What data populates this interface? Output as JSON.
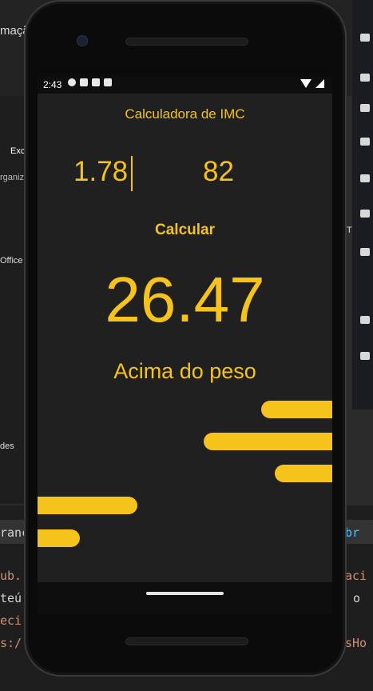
{
  "desktop": {
    "top_text": "maçã",
    "left_label_excluir": "Exc",
    "left_label_organize": "rganiz",
    "left_label_office": "Office",
    "left_label_des": "des",
    "right_label_t": "T",
    "code_line_1_left": "ranc",
    "code_line_1_right": "br",
    "code_line_2_left": "ub.",
    "code_line_2_right": "aci",
    "code_line_3_left": "teú",
    "code_line_3_right": "o ",
    "code_line_4_left": "eci",
    "code_line_5_left": "s:/",
    "code_line_5_right": "sHo"
  },
  "statusbar": {
    "time": "2:43"
  },
  "app": {
    "title": "Calculadora de IMC",
    "height_value": "1.78",
    "weight_value": "82",
    "calculate_label": "Calcular",
    "result_value": "26.47",
    "result_status": "Acima do peso"
  },
  "colors": {
    "accent": "#f6c21c",
    "screen_background": "#202020"
  }
}
